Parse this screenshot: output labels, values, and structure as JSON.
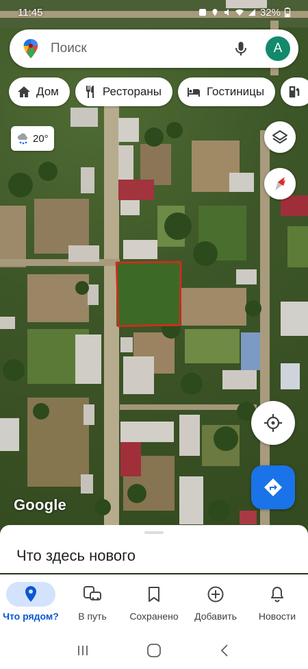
{
  "status_bar": {
    "time": "11:45",
    "battery": "32%"
  },
  "search": {
    "placeholder": "Поиск",
    "avatar_letter": "A"
  },
  "chips": [
    {
      "label": "Дом",
      "icon": "home-icon"
    },
    {
      "label": "Рестораны",
      "icon": "restaurant-icon"
    },
    {
      "label": "Гостиницы",
      "icon": "hotel-icon"
    },
    {
      "label": "",
      "icon": "gas-station-icon"
    }
  ],
  "weather": {
    "temperature": "20°",
    "icon": "rain-cloud-icon"
  },
  "map": {
    "attribution": "Google",
    "highlight_color": "#e0261b"
  },
  "bottom_sheet": {
    "title": "Что здесь нового"
  },
  "bottom_nav": {
    "items": [
      {
        "label": "Что рядом?",
        "icon": "location-pin-icon",
        "active": true
      },
      {
        "label": "В путь",
        "icon": "commute-icon",
        "active": false
      },
      {
        "label": "Сохранено",
        "icon": "bookmark-icon",
        "active": false
      },
      {
        "label": "Добавить",
        "icon": "add-circle-icon",
        "active": false
      },
      {
        "label": "Новости",
        "icon": "bell-icon",
        "active": false
      }
    ]
  },
  "colors": {
    "accent": "#1a73e8",
    "active_nav_bg": "#d3e3fd",
    "avatar_bg": "#138a6b"
  }
}
